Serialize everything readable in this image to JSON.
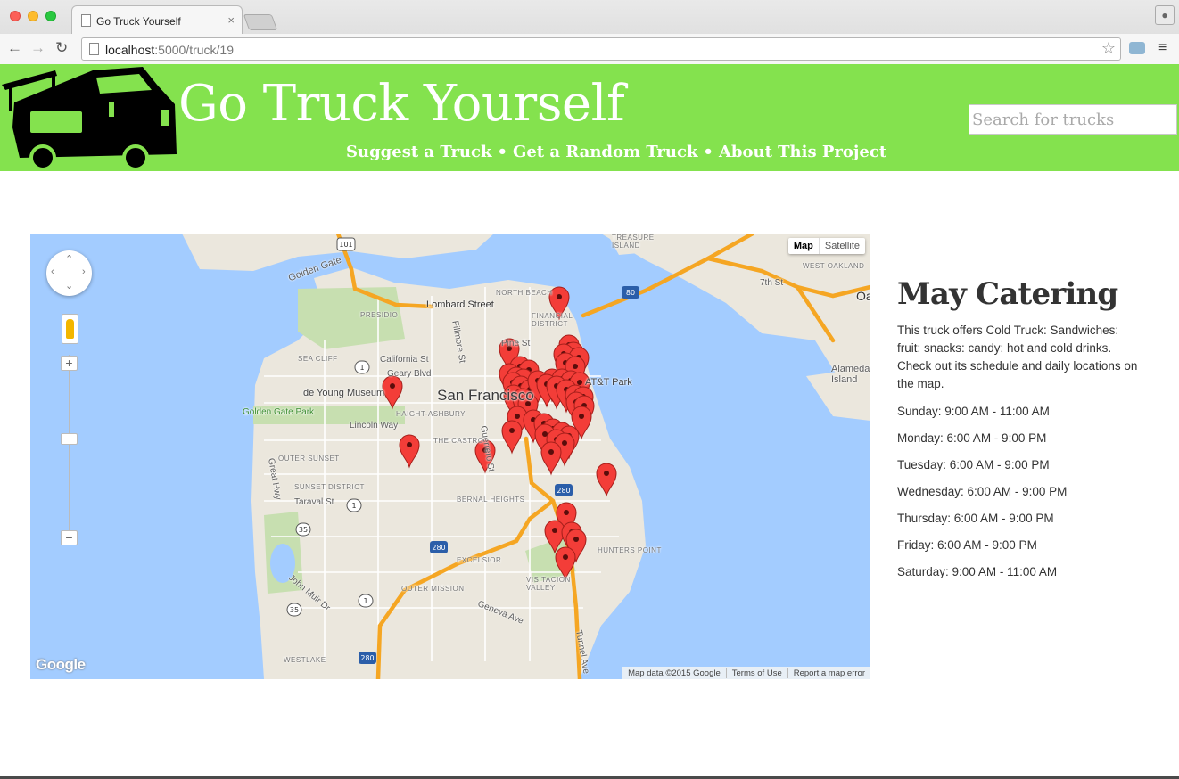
{
  "browser": {
    "tab_title": "Go Truck Yourself",
    "tab_close": "×",
    "url_host": "localhost",
    "url_path": ":5000/truck/19"
  },
  "header": {
    "title": "Go Truck Yourself",
    "nav": [
      "Suggest a Truck",
      "Get a Random Truck",
      "About This Project"
    ],
    "separator": "•",
    "search_placeholder": "Search for trucks"
  },
  "map": {
    "type_control": [
      "Map",
      "Satellite"
    ],
    "active_type": "Map",
    "zoom_in_label": "+",
    "zoom_out_label": "−",
    "logo": "Google",
    "attribution": [
      "Map data ©2015 Google",
      "Terms of Use",
      "Report a map error"
    ],
    "labels": [
      "Golden Gate",
      "NORTH BEACH",
      "Lombard Street",
      "PRESIDIO",
      "FINANCIAL DISTRICT",
      "Pine St",
      "SEA CLIFF",
      "California St",
      "Geary Blvd",
      "de Young Museum",
      "San Francisco",
      "Golden Gate Park",
      "AT&T Park",
      "HAIGHT-ASHBURY",
      "Lincoln Way",
      "THE CASTRO",
      "OUTER SUNSET",
      "SUNSET DISTRICT",
      "Taraval St",
      "BERNAL HEIGHTS",
      "EXCELSIOR",
      "OUTER MISSION",
      "Geneva Ave",
      "VISITACION VALLEY",
      "HUNTERS POINT",
      "WESTLAKE",
      "Great Hwy",
      "John Muir Dr",
      "Guerrero St",
      "Fillmore St",
      "TREASURE ISLAND",
      "WEST OAKLAND",
      "7th St",
      "Alameda Island",
      "Tunnel Ave",
      "Oa"
    ],
    "highway_shields": [
      "101",
      "80",
      "1",
      "280",
      "35"
    ],
    "marker_count": 52
  },
  "truck": {
    "name": "May Catering",
    "description": "This truck offers Cold Truck: Sandwiches: fruit: snacks: candy: hot and cold drinks. Check out its schedule and daily locations on the map.",
    "schedule": [
      "Sunday: 9:00 AM - 11:00 AM",
      "Monday: 6:00 AM - 9:00 PM",
      "Tuesday: 6:00 AM - 9:00 PM",
      "Wednesday: 6:00 AM - 9:00 PM",
      "Thursday: 6:00 AM - 9:00 PM",
      "Friday: 6:00 AM - 9:00 PM",
      "Saturday: 9:00 AM - 11:00 AM"
    ]
  },
  "colors": {
    "header_green": "#84e24e",
    "water": "#a3ccff",
    "land": "#ebe7dd",
    "park": "#c7dfb0",
    "highway": "#f5a623",
    "marker": "#f33d38"
  }
}
